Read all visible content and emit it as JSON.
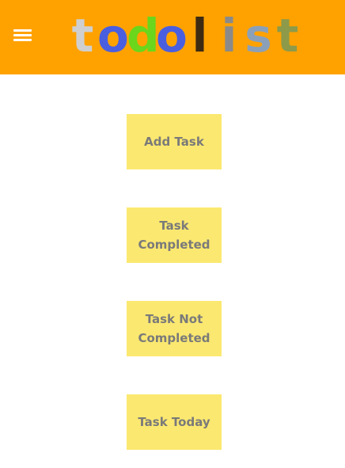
{
  "header": {
    "background_color": "#ffa200",
    "menu_icon": "hamburger-menu-icon",
    "logo_letters": [
      {
        "char": "t",
        "color": "#cfcfcf"
      },
      {
        "char": "o",
        "color": "#4a5fe0"
      },
      {
        "char": "d",
        "color": "#6ad61c"
      },
      {
        "char": "o",
        "color": "#4a5fe0"
      },
      {
        "char": "l",
        "color": "#3d2a12"
      },
      {
        "char": "i",
        "color": "#8a8a8a"
      },
      {
        "char": "s",
        "color": "#8aa0b8"
      },
      {
        "char": "t",
        "color": "#8c9a4a"
      }
    ]
  },
  "main": {
    "buttons": [
      {
        "label": "Add Task"
      },
      {
        "label": "Task Completed"
      },
      {
        "label": "Task Not Completed"
      },
      {
        "label": "Task Today"
      }
    ],
    "button_color": "#fbe870",
    "button_text_color": "#7a7a7a"
  }
}
